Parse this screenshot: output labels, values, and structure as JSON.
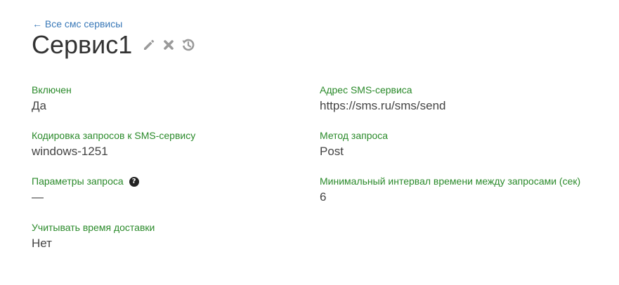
{
  "back_link": {
    "label": "← Все смс сервисы"
  },
  "header": {
    "title": "Сервис1",
    "icons": [
      "edit-icon",
      "delete-icon",
      "history-icon"
    ]
  },
  "fields": {
    "enabled": {
      "label": "Включен",
      "value": "Да"
    },
    "encoding": {
      "label": "Кодировка запросов к SMS-сервису",
      "value": "windows-1251"
    },
    "params": {
      "label": "Параметры запроса",
      "value": "—"
    },
    "delivery_time": {
      "label": "Учитывать время доставки",
      "value": "Нет"
    },
    "address": {
      "label": "Адрес SMS-сервиса",
      "value": "https://sms.ru/sms/send"
    },
    "method": {
      "label": "Метод запроса",
      "value": "Post"
    },
    "interval": {
      "label": "Минимальный интервал времени между запросами (сек)",
      "value": "6"
    }
  },
  "colors": {
    "label": "#2a8a2a",
    "link": "#3a79b8",
    "icon": "#9a9a9a"
  }
}
